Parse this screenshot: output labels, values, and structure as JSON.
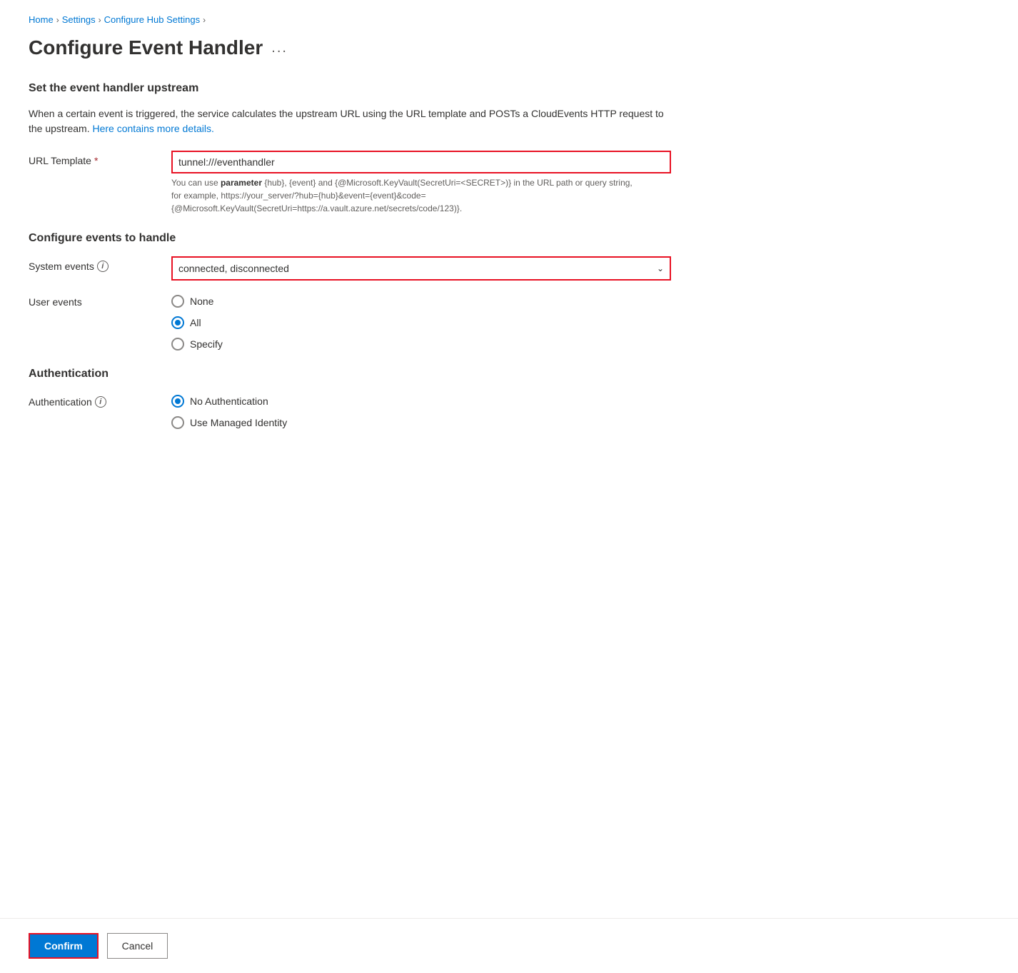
{
  "breadcrumb": {
    "home": "Home",
    "settings": "Settings",
    "configure": "Configure Hub Settings"
  },
  "page": {
    "title": "Configure Event Handler",
    "ellipsis": "..."
  },
  "upstream_section": {
    "title": "Set the event handler upstream",
    "description_part1": "When a certain event is triggered, the service calculates the upstream URL using the URL template and POSTs a CloudEvents HTTP request to the upstream.",
    "link_text": "Here contains more details.",
    "url_template_label": "URL Template",
    "url_template_value": "tunnel:///eventhandler",
    "hint": "You can use parameter {hub}, {event} and {@Microsoft.KeyVault(SecretUri=<SECRET>)} in the URL path or query string, for example, https://your_server/?hub={hub}&event={event}&code={@Microsoft.KeyVault(SecretUri=https://a.vault.azure.net/secrets/code/123)}."
  },
  "events_section": {
    "title": "Configure events to handle",
    "system_events_label": "System events",
    "system_events_value": "connected, disconnected",
    "user_events_label": "User events",
    "user_events_options": [
      {
        "id": "none",
        "label": "None",
        "checked": false
      },
      {
        "id": "all",
        "label": "All",
        "checked": true
      },
      {
        "id": "specify",
        "label": "Specify",
        "checked": false
      }
    ]
  },
  "auth_section": {
    "title": "Authentication",
    "auth_label": "Authentication",
    "auth_options": [
      {
        "id": "no-auth",
        "label": "No Authentication",
        "checked": true
      },
      {
        "id": "managed-identity",
        "label": "Use Managed Identity",
        "checked": false
      }
    ]
  },
  "footer": {
    "confirm_label": "Confirm",
    "cancel_label": "Cancel"
  }
}
